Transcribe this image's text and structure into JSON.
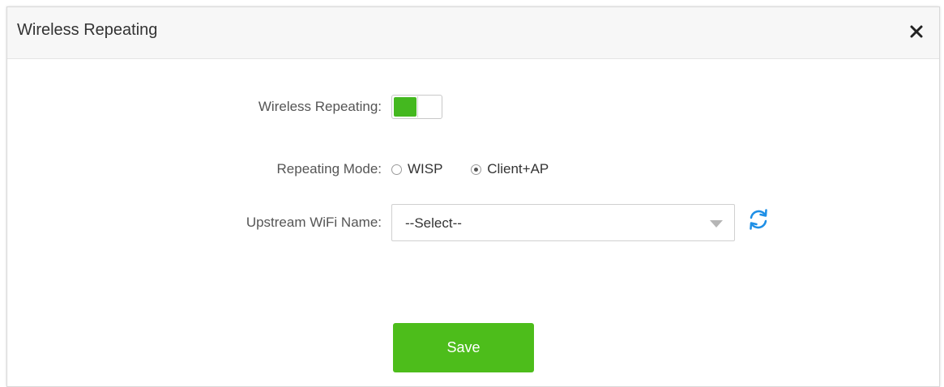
{
  "dialog": {
    "title": "Wireless Repeating",
    "close_icon": "close-icon"
  },
  "form": {
    "wireless_repeating_label": "Wireless Repeating:",
    "wireless_repeating_enabled": true,
    "repeating_mode_label": "Repeating Mode:",
    "modes": [
      {
        "label": "WISP",
        "selected": false
      },
      {
        "label": "Client+AP",
        "selected": true
      }
    ],
    "upstream_label": "Upstream WiFi Name:",
    "upstream_value": "--Select--",
    "refresh_icon": "refresh-icon"
  },
  "actions": {
    "save_label": "Save"
  },
  "colors": {
    "accent": "#4dbd1b",
    "refresh": "#1e8fe6"
  }
}
